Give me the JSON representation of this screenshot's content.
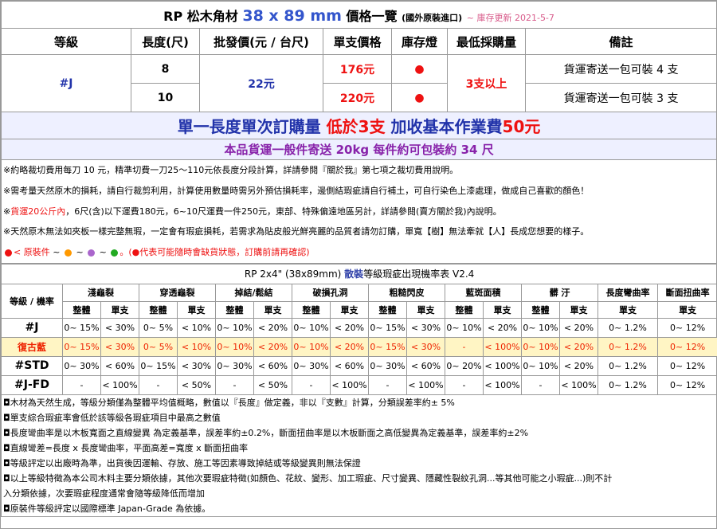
{
  "title": {
    "prefix": "RP 松木角材",
    "size": "38 x 89 mm",
    "suffix": "價格一覽",
    "origin": "(國外原裝進口)",
    "updated": "~ 庫存更新 2021-5-7"
  },
  "headers": [
    "等級",
    "長度(尺)",
    "批發價(元 / 台尺)",
    "單支價格",
    "庫存燈",
    "最低採購量",
    "備註"
  ],
  "product": {
    "grade": "#J",
    "wholesale_price": "22元",
    "min_purchase": "3支以上",
    "rows": [
      {
        "length": "8",
        "unit_price": "176元",
        "stock": "●",
        "remark": "貨運寄送一包可裝 4 支"
      },
      {
        "length": "10",
        "unit_price": "220元",
        "stock": "●",
        "remark": "貨運寄送一包可裝 3 支"
      }
    ]
  },
  "banner1": {
    "part1": "單一長度單次訂購量",
    "part2": "低於3支",
    "part3": "加收基本作業費",
    "part4": "50元"
  },
  "banner2": "本品貨運一般件寄送 20kg 每件約可包裝約 34 尺",
  "notes": [
    "※約略裁切費用每刀 10 元，精準切費一刀25～110元依長度分段計算，詳請參閱『關於我』第七項之裁切費用說明。",
    "※需考量天然原木的損耗，請自行裁剪利用，計算使用數量時需另外預估損耗率，邊側結瑕疵請自行補土，可自行染色上漆處理，做成自己喜歡的顏色！",
    "※",
    "貨運20公斤內",
    "，6尺(含)以下運費180元，6~10尺運費一件250元，東部、特殊偏遠地區另計，詳請參閱(賣方關於我)內說明。",
    "※天然原木無法如夾板一樣完整無瑕，一定會有瑕疵損耗，若需求為貼皮般光鮮亮麗的品質者請勿訂購，單寬【樹】無法牽就【人】長成您想要的樣子。"
  ],
  "legend": {
    "label": "< 原裝件",
    "sep": "~",
    "note": "。(●代表可能隨時會缺貨狀態，訂購前請再確認)",
    "colors": [
      "#ee1111",
      "#ff9900",
      "#aa66cc",
      "#22aa22"
    ]
  },
  "defects": {
    "title_prefix": "RP 2x4\" (38x89mm)",
    "title_em": "散裝",
    "title_suffix": "等級瑕疵出現機率表 V2.4",
    "row_header": "等級 / 機率",
    "categories": [
      "淺龜裂",
      "穿透龜裂",
      "掉結/鬆結",
      "破損孔洞",
      "粗糙閃皮",
      "藍斑面積",
      "髒 汙",
      "長度彎曲率",
      "斷面扭曲率"
    ],
    "sub_whole": "整體",
    "sub_single": "單支",
    "rows": [
      {
        "grade": "#J",
        "cells": [
          "0~ 15%",
          "< 30%",
          "0~ 5%",
          "< 10%",
          "0~ 10%",
          "< 20%",
          "0~ 10%",
          "< 20%",
          "0~ 15%",
          "< 30%",
          "0~ 10%",
          "< 20%",
          "0~ 10%",
          "< 20%",
          "0~ 1.2%",
          "0~ 12%"
        ]
      },
      {
        "grade": "復古藍",
        "cells": [
          "0~ 15%",
          "< 30%",
          "0~ 5%",
          "< 10%",
          "0~ 10%",
          "< 20%",
          "0~ 10%",
          "< 20%",
          "0~ 15%",
          "< 30%",
          "-",
          "< 100%",
          "0~ 10%",
          "< 20%",
          "0~ 1.2%",
          "0~ 12%"
        ]
      },
      {
        "grade": "#STD",
        "cells": [
          "0~ 30%",
          "< 60%",
          "0~ 15%",
          "< 30%",
          "0~ 30%",
          "< 60%",
          "0~ 30%",
          "< 60%",
          "0~ 30%",
          "< 60%",
          "0~ 20%",
          "< 100%",
          "0~ 10%",
          "< 20%",
          "0~ 1.2%",
          "0~ 12%"
        ]
      },
      {
        "grade": "#J-FD",
        "cells": [
          "-",
          "< 100%",
          "-",
          "< 50%",
          "-",
          "< 50%",
          "-",
          "< 100%",
          "-",
          "< 100%",
          "-",
          "< 100%",
          "-",
          "< 100%",
          "0~ 1.2%",
          "0~ 12%"
        ]
      }
    ]
  },
  "bottom_notes": [
    "◘木材為天然生成，等級分類僅為整體平均值概略，數值以『長度』做定義，非以『支數』計算，分類誤差率約± 5%",
    "◘單支綜合瑕疵率會低於該等級各瑕疵項目中最高之數值",
    "◘長度彎曲率是以木板寬面之直線變異 為定義基準，誤差率約±0.2%，斷面扭曲率是以木板斷面之高低變異為定義基準，誤差率約±2%",
    "◘直線彎差=長度 x 長度彎曲率，平面高差=寬度 x 斷面扭曲率",
    "◘等級評定以出廠時為準，出貨後因運輸、存放、施工等因素導致掉結或等級變異則無法保證",
    "◘以上等級特徵為本公司木料主要分類依據，其他次要瑕疵特徵(如顏色、花紋、變形、加工瑕疵、尺寸變異、隱藏性裂紋孔洞...等其他可能之小瑕疵...)則不計",
    "入分類依據，次要瑕疵程度通常會隨等級降低而增加",
    "◘原裝件等級評定以國際標準 Japan-Grade 為依據。"
  ]
}
